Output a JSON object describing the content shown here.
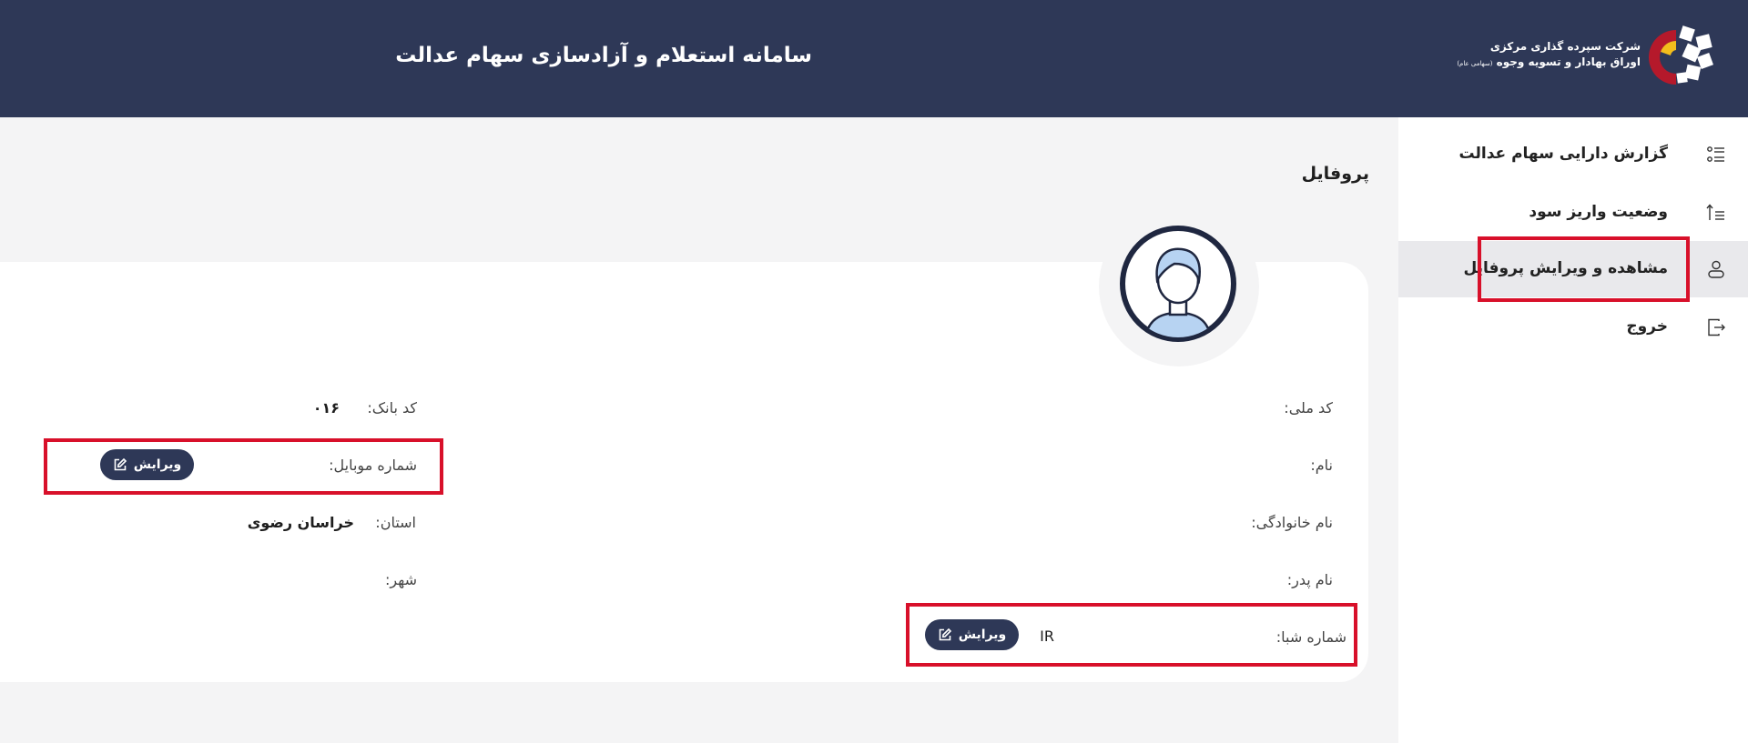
{
  "header": {
    "title": "سامانه استعلام و آزادسازی سهام عدالت",
    "logo_line1": "شرکت سپرده گذاری مرکزی",
    "logo_line2": "اوراق بهادار و تسویه وجوه",
    "logo_line2_small": "(سهامی عام)"
  },
  "sidebar": {
    "items": [
      {
        "label": "گزارش دارایی سهام عدالت",
        "icon": "list-icon"
      },
      {
        "label": "وضعیت واریز سود",
        "icon": "sort-ascending-icon"
      },
      {
        "label": "مشاهده و ویرایش پروفایل",
        "icon": "user-icon",
        "active": true
      },
      {
        "label": "خروج",
        "icon": "logout-icon"
      }
    ]
  },
  "page": {
    "title": "پروفایل"
  },
  "profile": {
    "national_code_label": "کد ملی:",
    "first_name_label": "نام:",
    "last_name_label": "نام خانوادگی:",
    "father_name_label": "نام پدر:",
    "sheba_label": "شماره شبا:",
    "sheba_value": "IR",
    "bank_code_label": "کد بانک:",
    "bank_code_value": "۰۱۶",
    "mobile_label": "شماره موبایل:",
    "province_label": "استان:",
    "province_value": "خراسان رضوی",
    "city_label": "شهر:",
    "edit_label": "ویرایش"
  },
  "colors": {
    "header": "#2e3857",
    "highlight": "#d8102a",
    "button": "#2e3857"
  }
}
